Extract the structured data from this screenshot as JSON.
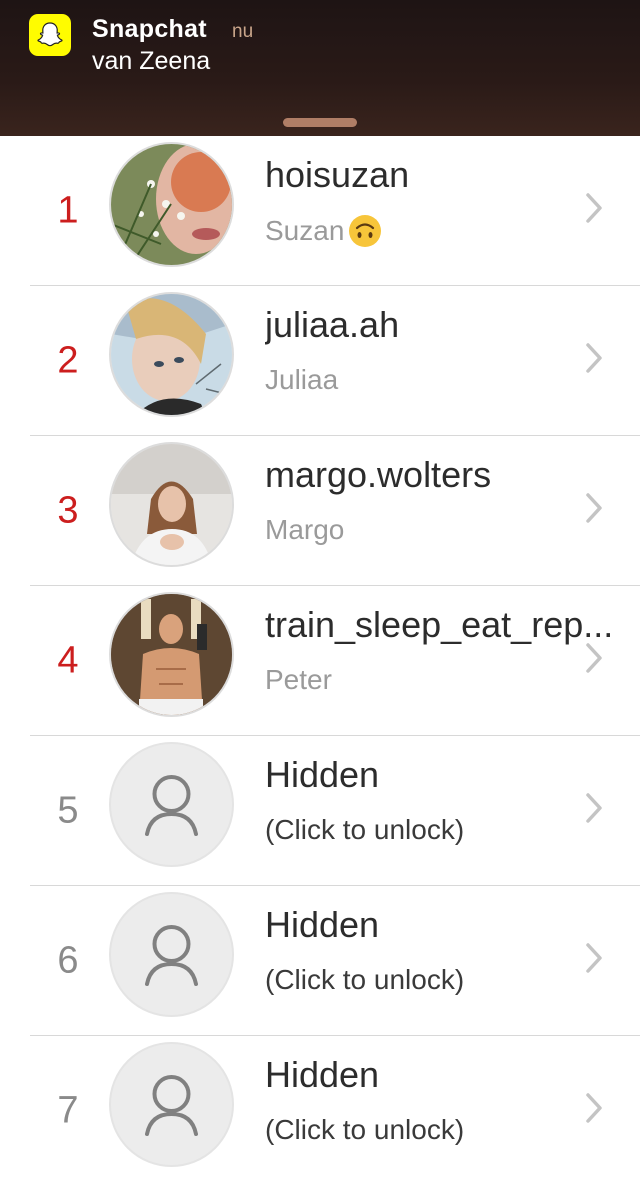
{
  "notification": {
    "app_name": "Snapchat",
    "time": "nu",
    "message": "van Zeena",
    "icon": "snapchat-ghost-icon",
    "accent": "#fffc00"
  },
  "rank_color": "#cc1e1e",
  "rows": [
    {
      "rank": "1",
      "username": "hoisuzan",
      "display_name": "Suzan",
      "emoji": "upside-down-face-emoji",
      "avatar": "profile-photo"
    },
    {
      "rank": "2",
      "username": "juliaa.ah",
      "display_name": "Juliaa",
      "avatar": "profile-photo"
    },
    {
      "rank": "3",
      "username": "margo.wolters",
      "display_name": "Margo",
      "avatar": "profile-photo"
    },
    {
      "rank": "4",
      "username": "train_sleep_eat_rep...",
      "display_name": "Peter",
      "avatar": "profile-photo"
    },
    {
      "rank": "5",
      "username": "Hidden",
      "display_name": "(Click to unlock)",
      "avatar": "person-placeholder-icon"
    },
    {
      "rank": "6",
      "username": "Hidden",
      "display_name": "(Click to unlock)",
      "avatar": "person-placeholder-icon"
    },
    {
      "rank": "7",
      "username": "Hidden",
      "display_name": "(Click to unlock)",
      "avatar": "person-placeholder-icon"
    }
  ]
}
